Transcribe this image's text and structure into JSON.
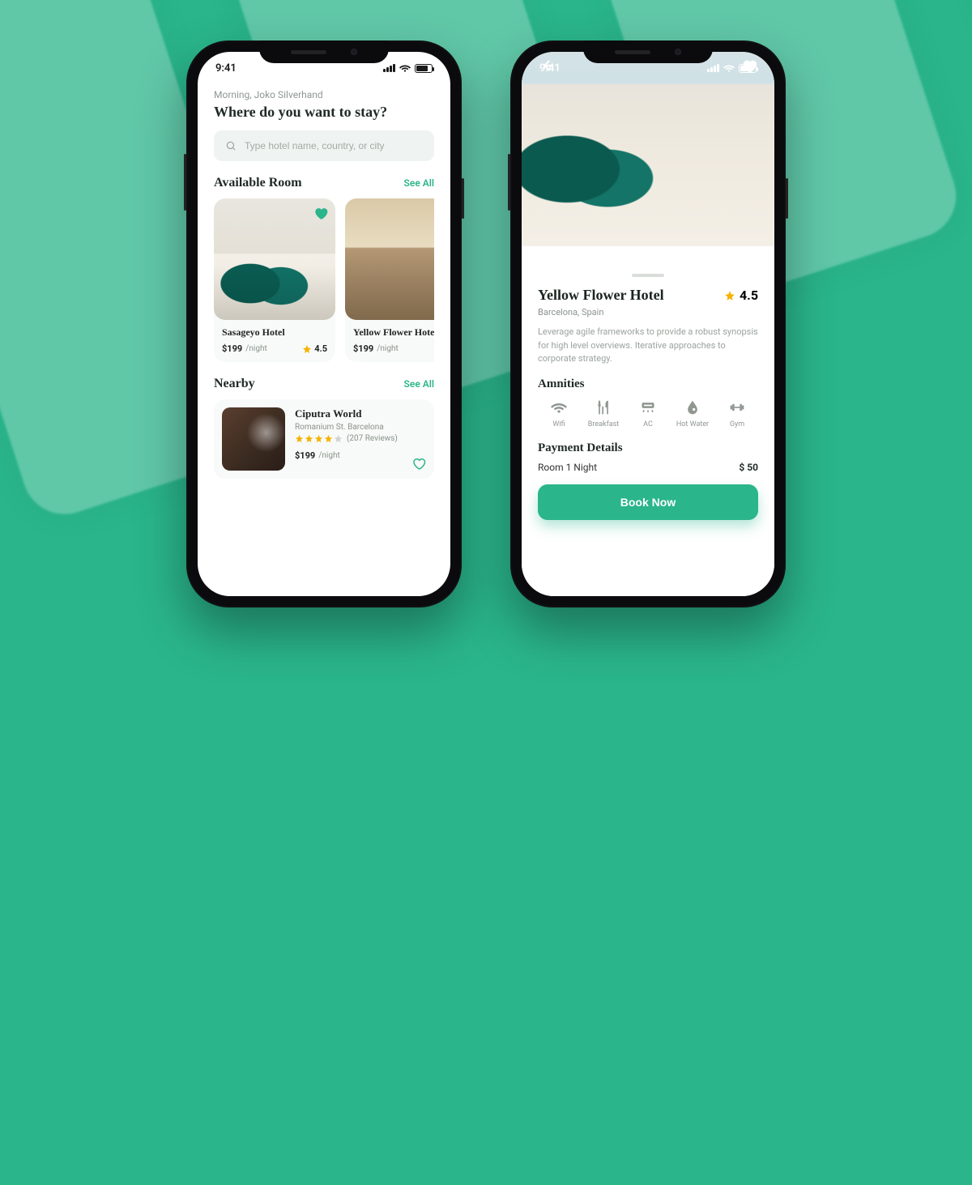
{
  "status": {
    "time": "9:41"
  },
  "colors": {
    "accent": "#2ab58a",
    "star": "#f5b301"
  },
  "home": {
    "greeting": "Morning, Joko Silverhand",
    "headline": "Where do you want to stay?",
    "search": {
      "placeholder": "Type hotel name, country, or city"
    },
    "available": {
      "title": "Available Room",
      "see_all": "See All",
      "rooms": [
        {
          "name": "Sasageyo Hotel",
          "price": "$199",
          "per": "/night",
          "rating": "4.5",
          "favorited": true
        },
        {
          "name": "Yellow Flower Hotel",
          "price": "$199",
          "per": "/night"
        }
      ]
    },
    "nearby": {
      "title": "Nearby",
      "see_all": "See All",
      "item": {
        "name": "Ciputra World",
        "address": "Romanium St. Barcelona",
        "stars_filled": 4,
        "reviews": "(207 Reviews)",
        "price": "$199",
        "per": "/night"
      }
    }
  },
  "detail": {
    "title": "Yellow Flower Hotel",
    "rating": "4.5",
    "location": "Barcelona, Spain",
    "description": "Leverage agile frameworks to provide a robust synopsis for high level overviews. Iterative approaches to corporate strategy.",
    "amenities_title": "Amnities",
    "amenities": [
      {
        "key": "wifi",
        "label": "Wifi"
      },
      {
        "key": "breakfast",
        "label": "Breakfast"
      },
      {
        "key": "ac",
        "label": "AC"
      },
      {
        "key": "hotwater",
        "label": "Hot Water"
      },
      {
        "key": "gym",
        "label": "Gym"
      }
    ],
    "payment_title": "Payment Details",
    "payment_line": "Room 1 Night",
    "payment_price": "$ 50",
    "cta": "Book Now"
  }
}
